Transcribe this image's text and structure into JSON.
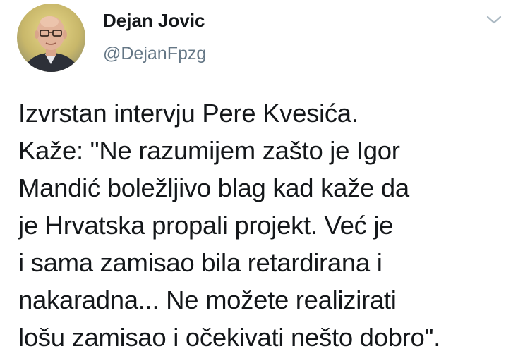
{
  "author": {
    "display_name": "Dejan Jovic",
    "handle": "@DejanFpzg"
  },
  "icons": {
    "avatar": "profile-photo",
    "menu": "chevron-down-icon"
  },
  "tweet": {
    "lines": [
      "Izvrstan intervju Pere Kvesića.",
      "Kaže: \"Ne razumijem zašto je Igor",
      "Mandić boležljivo blag kad kaže da",
      "je Hrvatska propali projekt. Već je",
      "i sama zamisao bila retardirana i",
      "nakaradna... Ne možete realizirati",
      "lošu zamisao i očekivati nešto dobro\"."
    ]
  },
  "colors": {
    "name_text": "#14171a",
    "handle_text": "#657786",
    "chevron": "#aab8c2"
  }
}
